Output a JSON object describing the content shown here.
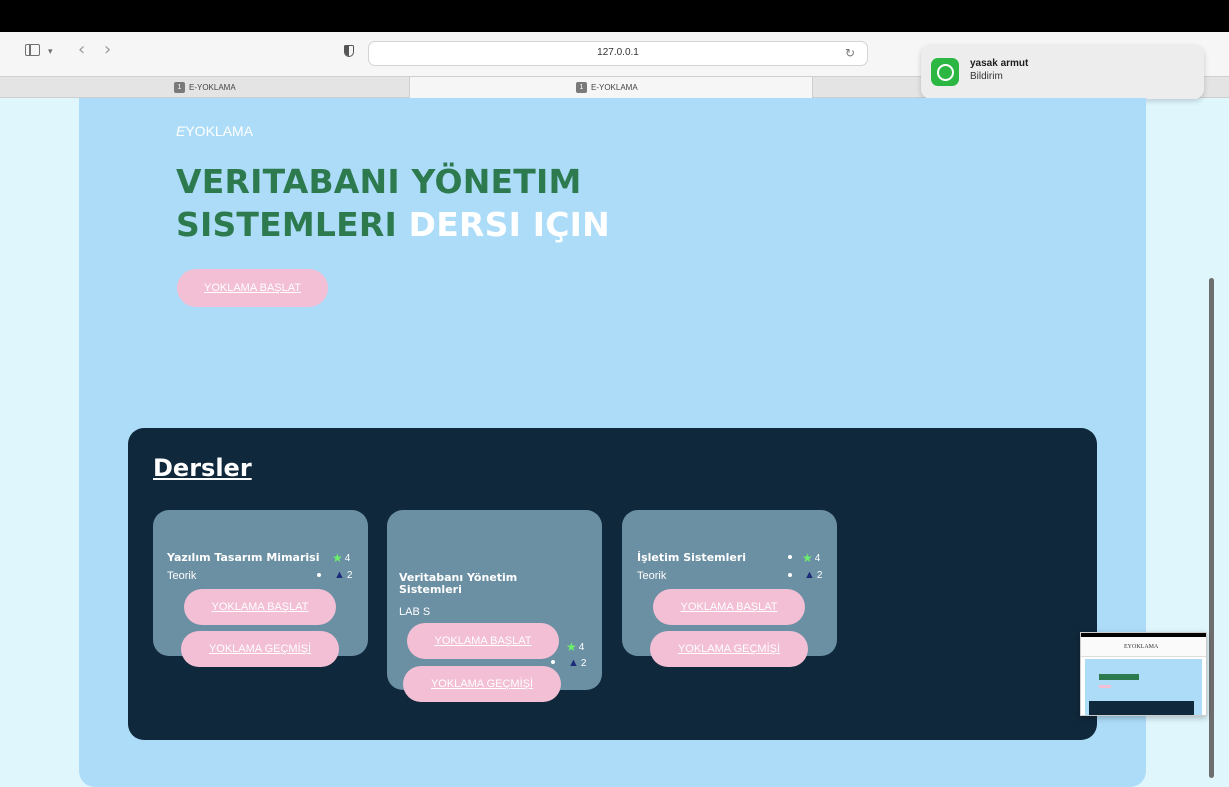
{
  "browser": {
    "url": "127.0.0.1",
    "tabs": [
      {
        "favicon": "1",
        "label": "E-YOKLAMA"
      },
      {
        "favicon": "1",
        "label": "E-YOKLAMA"
      }
    ]
  },
  "notification": {
    "app_icon": "whatsapp-icon",
    "title": "yasak armut",
    "body": "Bildirim"
  },
  "header": {
    "brand_e": "E",
    "brand_rest": "YOKLAMA",
    "title_line1": "VERITABANI YÖNETIM",
    "title_line2_green": "SISTEMLERI",
    "title_line2_white": "DERSI IÇIN",
    "start_button": "YOKLAMA BAŞLAT"
  },
  "courses": {
    "title": "Dersler",
    "items": [
      {
        "name": "Yazılım Tasarım Mimarisi",
        "type": "Teorik",
        "stars": "4",
        "warnings": "2",
        "start_label": "YOKLAMA BAŞLAT",
        "history_label": "YOKLAMA GEÇMİŞİ"
      },
      {
        "name": "Veritabanı Yönetim Sistemleri",
        "type": "LAB S",
        "stars": "4",
        "warnings": "2",
        "start_label": "YOKLAMA BAŞLAT",
        "history_label": "YOKLAMA GEÇMİŞİ"
      },
      {
        "name": "İşletim Sistemleri",
        "type": "Teorik",
        "stars": "4",
        "warnings": "2",
        "start_label": "YOKLAMA BAŞLAT",
        "history_label": "YOKLAMA GEÇMİŞİ"
      }
    ]
  },
  "thumbnail": {
    "label": "EYOKLAMA"
  },
  "colors": {
    "page_bg": "#addcf8",
    "accent_green": "#2d7a4e",
    "panel_dark": "#10283b",
    "card": "#6b8fa3",
    "pink_button": "#f3bfd4"
  }
}
